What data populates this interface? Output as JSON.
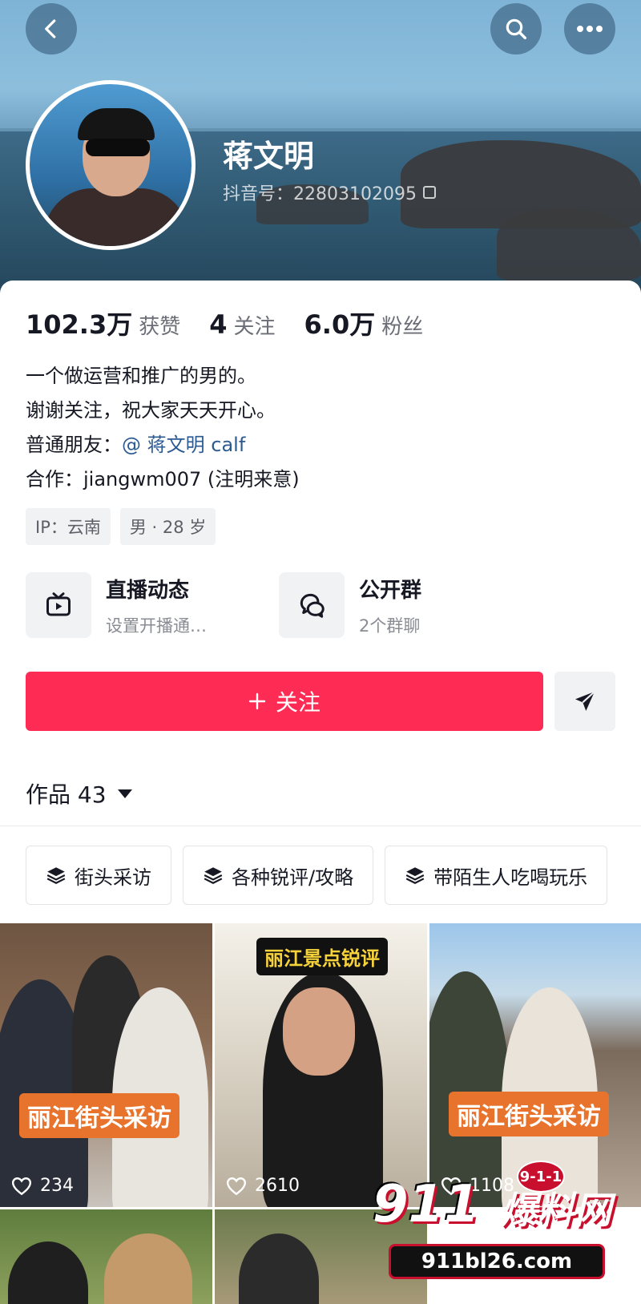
{
  "header": {
    "back_icon": "chevron-left-icon",
    "search_icon": "search-icon",
    "more_icon": "more-horizontal-icon"
  },
  "profile": {
    "name": "蒋文明",
    "douyin_id": "抖音号：22803102095"
  },
  "stats": [
    {
      "value": "102.3万",
      "label": "获赞"
    },
    {
      "value": "4",
      "label": "关注"
    },
    {
      "value": "6.0万",
      "label": "粉丝"
    }
  ],
  "bio": {
    "line1": "一个做运营和推广的男的。",
    "line2": "谢谢关注，祝大家天天开心。",
    "line3_prefix": "普通朋友：",
    "line3_mention": "@ 蒋文明 calf",
    "line4": "合作：jiangwm007 (注明来意)"
  },
  "tags": [
    "IP：云南",
    "男 · 28 岁"
  ],
  "features": [
    {
      "title": "直播动态",
      "subtitle": "设置开播通…",
      "icon": "tv-icon"
    },
    {
      "title": "公开群",
      "subtitle": "2个群聊",
      "icon": "chat-bubbles-icon"
    }
  ],
  "follow_button": {
    "label": "关注",
    "icon": "plus-icon"
  },
  "share_icon": "send-icon",
  "works": {
    "label": "作品 43"
  },
  "collections": [
    "街头采访",
    "各种锐评/攻略",
    "带陌生人吃喝玩乐"
  ],
  "videos": [
    {
      "overlay": "丽江街头采访",
      "likes": "234"
    },
    {
      "overlay": "丽江景点锐评",
      "likes": "2610"
    },
    {
      "overlay": "丽江街头采访",
      "likes": "1108"
    },
    {
      "overlay": "",
      "likes": ""
    },
    {
      "overlay": "",
      "likes": ""
    }
  ],
  "watermark": {
    "badge": "9-1-1",
    "number": "911",
    "brand": "爆料网",
    "url": "911bl26.com"
  },
  "colors": {
    "accent": "#fe2c55",
    "mention": "#2c5a92"
  }
}
